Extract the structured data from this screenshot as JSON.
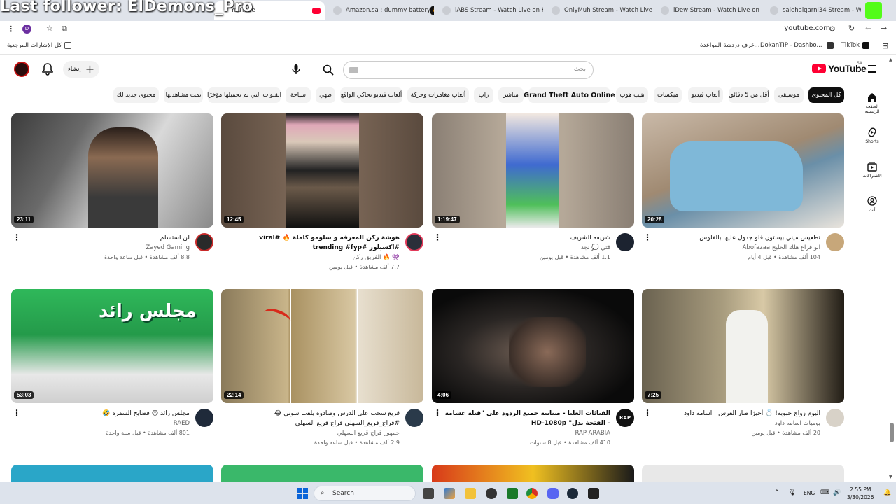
{
  "overlay": {
    "text": "Last follower: ElDemons_Pro"
  },
  "browser": {
    "tabs": [
      {
        "title": "YouTube",
        "active": true,
        "icon": "youtube-icon"
      },
      {
        "title": "Amazon.sa : dummy battery",
        "active": false,
        "icon": "amazon-icon"
      },
      {
        "title": "iABS Stream - Watch Live on Ki",
        "active": false,
        "icon": "kick-icon"
      },
      {
        "title": "OnlyMuh Stream - Watch Live",
        "active": false,
        "icon": "kick-icon"
      },
      {
        "title": "iDew Stream - Watch Live on Ki",
        "active": false,
        "icon": "kick-icon"
      },
      {
        "title": "salehalqarni34 Stream - Watch",
        "active": false,
        "icon": "kick-icon"
      }
    ],
    "profile_letter": "D",
    "url": "youtube.com",
    "bookmarks": {
      "all_bookmarks": "كل الإشارات المرجعية",
      "items": [
        "TikTok",
        "DokanTIP - Dashbo...",
        "غرف دردشة المواعدة..."
      ]
    }
  },
  "youtube": {
    "logo_text": "YouTube",
    "region": "SA",
    "search_placeholder": "بحث",
    "create_label": "إنشاء",
    "chips": [
      {
        "label": "كل المحتوى",
        "active": true
      },
      {
        "label": "موسيقى"
      },
      {
        "label": "أقل من 5 دقائق"
      },
      {
        "label": "ألعاب فيديو"
      },
      {
        "label": "ميكسات"
      },
      {
        "label": "هيب هوب"
      },
      {
        "label": "Grand Theft Auto Online",
        "bold": true
      },
      {
        "label": "مباشر"
      },
      {
        "label": "راب"
      },
      {
        "label": "ألعاب مغامرات وحركة"
      },
      {
        "label": "ألعاب فيديو تحاكي الواقع"
      },
      {
        "label": "طهي"
      },
      {
        "label": "سياحة"
      },
      {
        "label": "القنوات التي تم تحميلها مؤخرًا"
      },
      {
        "label": "تمت مشاهدتها"
      },
      {
        "label": "محتوى جديد لك"
      }
    ],
    "sidebar": [
      {
        "label": "الصفحة الرئيسية",
        "icon": "home-icon"
      },
      {
        "label": "Shorts",
        "icon": "shorts-icon"
      },
      {
        "label": "الاشتراكات",
        "icon": "subscriptions-icon"
      },
      {
        "label": "أنت",
        "icon": "you-icon"
      }
    ],
    "videos": [
      {
        "title": "تطعيس ميني بيستون فلو جدول عليها بالفلوس",
        "channel": "Abofazaa ابو فزاع هلك الخليج",
        "stats": "104 ألف مشاهدة • قبل 4 أيام",
        "duration": "20:28",
        "verified": true
      },
      {
        "title": "شريفه الشريف",
        "channel": "فتي 💭 نجد",
        "stats": "1.1 ألف مشاهدة • قبل يومين",
        "duration": "1:19:47"
      },
      {
        "title": "هوشة ركن المعرفه و سلومو كاملة 🔥 #viral #اكسبلور #trending #fyp",
        "channel": "الفريق ركن 🔥 👾",
        "stats": "7.7 ألف مشاهدة • قبل يومين",
        "duration": "12:45"
      },
      {
        "title": "لن استسلم",
        "channel": "Zayed Gaming",
        "stats": "8.8 ألف مشاهدة • قبل ساعة واحدة",
        "duration": "23:11",
        "verified": true
      },
      {
        "title": "اليوم زواج حبوبه! 💍 أخيرًا صار العرس | اسامه داود",
        "channel": "يوميات اسامه داود",
        "stats": "20 ألف مشاهدة • قبل يومين",
        "duration": "7:25"
      },
      {
        "title": "القبائات العليا - صنابية جميع الردود على \"قتلة عشامة - القتحة بدل\" HD-1080p",
        "channel": "RAP ARABIA",
        "stats": "410 ألف مشاهدة • قبل 8 سنوات",
        "duration": "4:06"
      },
      {
        "title": "قريع سحب على الدرس وصادوه يلعب سوني 😂 #قراج_قريع_السهلي قراج قريع السهلي",
        "channel": "جمهور قراج قريع السهلي",
        "stats": "2.9 ألف مشاهدة • قبل ساعة واحدة",
        "duration": "22:14"
      },
      {
        "title": "مجلس رائد 😍 فضايح السفره 🤣!",
        "channel": "RAED",
        "stats": "801 ألف مشاهدة • قبل سنة واحدة",
        "duration": "53:03",
        "verified": true
      }
    ]
  },
  "taskbar": {
    "search_label": "Search",
    "lang": "ENG",
    "time": "2:55 PM",
    "date": "3/30/2026"
  }
}
